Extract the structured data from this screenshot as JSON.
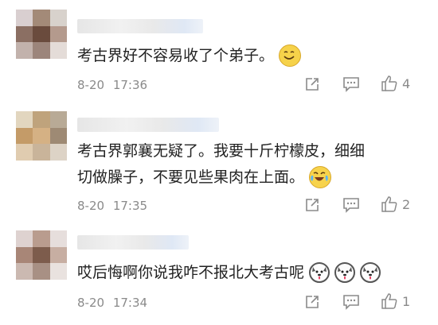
{
  "comments": [
    {
      "lines": [
        "考古界好不容易收了个弟子。"
      ],
      "emojis": [
        "smile-emoji"
      ],
      "date": "8-20",
      "time": "17:36",
      "likes": "4"
    },
    {
      "lines": [
        "考古界郭襄无疑了。我要十斤柠檬皮，细细",
        "切做臊子，不要见些果肉在上面。"
      ],
      "emojis": [
        "laugh-cry-emoji"
      ],
      "date": "8-20",
      "time": "17:35",
      "likes": "2"
    },
    {
      "lines": [
        "哎后悔啊你说我咋不报北大考古呢"
      ],
      "emojis": [
        "husky-emoji",
        "husky-emoji",
        "husky-emoji"
      ],
      "date": "8-20",
      "time": "17:34",
      "likes": "1"
    }
  ],
  "icons": {
    "share": "share-icon",
    "comment": "comment-icon",
    "like": "thumbs-up-icon"
  },
  "colors": {
    "text": "#222222",
    "meta": "#8a8a8a",
    "icon": "#8a8a8a"
  }
}
